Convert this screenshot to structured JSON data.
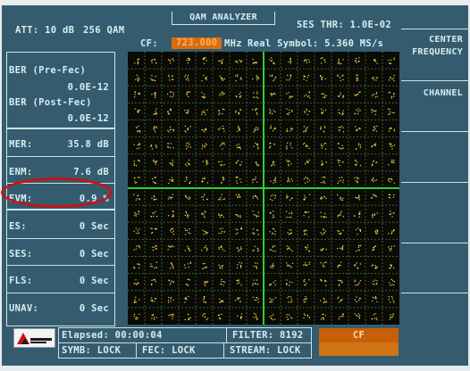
{
  "header": {
    "att": "ATT: 10 dB",
    "qam_mode": "256 QAM",
    "title": "QAM ANALYZER",
    "ses_thr": "SES THR: 1.0E-02",
    "cf_label": "CF:",
    "cf_value": "723.000",
    "cf_unit": "MHz",
    "real_symbol": "Real Symbol: 5.360 MS/s"
  },
  "measurements": [
    {
      "label": "BER (Pre-Fec)",
      "value": "0.0E-12"
    },
    {
      "label": "BER (Post-Fec)",
      "value": "0.0E-12"
    },
    {
      "label": "MER:",
      "value": "35.8 dB"
    },
    {
      "label": "ENM:",
      "value": "7.6 dB"
    },
    {
      "label": "EVM:",
      "value": "0.9 %"
    },
    {
      "label": "ES:",
      "value": "0 Sec"
    },
    {
      "label": "SES:",
      "value": "0 Sec"
    },
    {
      "label": "FLS:",
      "value": "0 Sec"
    },
    {
      "label": "UNAV:",
      "value": "0 Sec"
    }
  ],
  "softkeys": {
    "center_frequency_line1": "CENTER",
    "center_frequency_line2": "FREQUENCY",
    "channel": "CHANNEL",
    "cf": "CF"
  },
  "status": {
    "elapsed": "Elapsed: 00:00:04",
    "filter": "FILTER: 8192",
    "symb": "SYMB: LOCK",
    "fec": "FEC: LOCK",
    "stream": "STREAM: LOCK"
  },
  "logo_text": "Promax",
  "constellation": {
    "order": 256,
    "grid": "16x16"
  },
  "colors": {
    "panel": "#355c6e",
    "text": "#d6eef3",
    "highlight": "#d86d10",
    "points": "#f2e14a",
    "grid": "#2f6b2f",
    "axes": "#2ed12e",
    "annotation": "#cc1111"
  }
}
